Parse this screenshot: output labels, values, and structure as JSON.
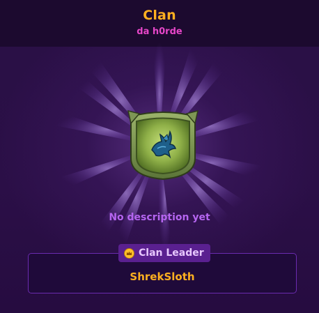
{
  "header": {
    "title": "Clan",
    "subtitle": "da h0rde"
  },
  "emblem": {
    "icon": "pegasus-icon",
    "frame": "green-shield-frame"
  },
  "description": "No description yet",
  "leader": {
    "badge_label": "Clan Leader",
    "badge_icon": "crown-icon",
    "name": "ShrekSloth"
  },
  "colors": {
    "title": "#ffb020",
    "subtitle": "#e646c8",
    "description": "#b565f0",
    "leader_name": "#ffb020",
    "card_border": "#6b2bb0",
    "badge_bg": "#5a2090"
  }
}
